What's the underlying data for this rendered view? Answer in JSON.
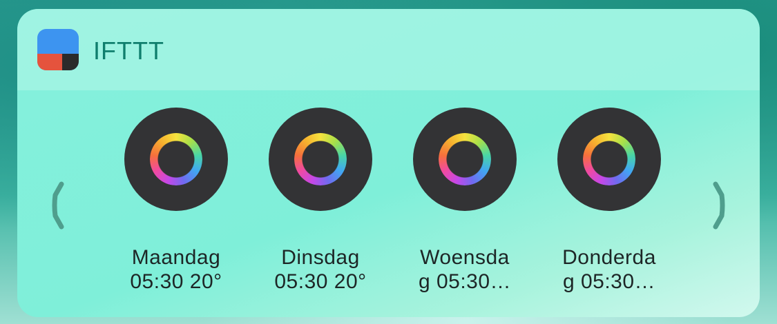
{
  "widget": {
    "app_name": "IFTTT",
    "app_icon": "ifttt-logo-icon",
    "nav": {
      "prev_icon": "chevron-left-icon",
      "next_icon": "chevron-right-icon"
    },
    "items": [
      {
        "label": "Maandag\n05:30 20°",
        "icon": "color-ring-icon"
      },
      {
        "label": "Dinsdag\n05:30 20°",
        "icon": "color-ring-icon"
      },
      {
        "label": "Woensda\ng 05:30…",
        "icon": "color-ring-icon"
      },
      {
        "label": "Donderda\ng 05:30…",
        "icon": "color-ring-icon"
      }
    ]
  },
  "colors": {
    "widget_bg": "#86f0dd",
    "title": "#0f7e6d",
    "tile_bg": "#333335",
    "icon_blue": "#3d94f0",
    "icon_red": "#e5533d",
    "icon_dark": "#2b2b2b"
  }
}
